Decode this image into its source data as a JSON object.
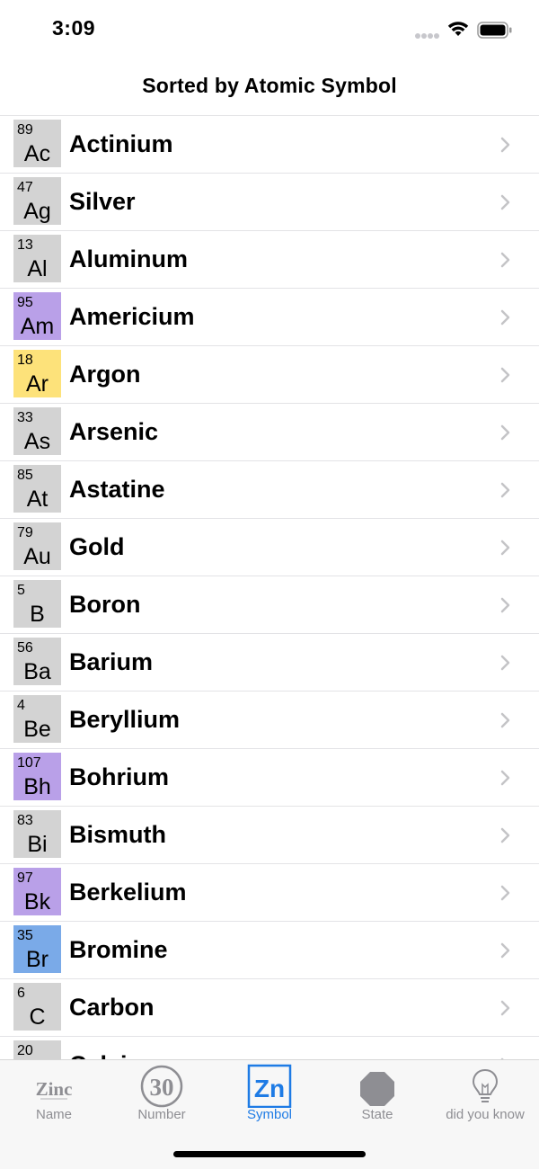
{
  "status": {
    "time": "3:09"
  },
  "nav": {
    "title": "Sorted by Atomic Symbol"
  },
  "elements": [
    {
      "number": "89",
      "symbol": "Ac",
      "name": "Actinium",
      "color": "#d3d3d3"
    },
    {
      "number": "47",
      "symbol": "Ag",
      "name": "Silver",
      "color": "#d3d3d3"
    },
    {
      "number": "13",
      "symbol": "Al",
      "name": "Aluminum",
      "color": "#d3d3d3"
    },
    {
      "number": "95",
      "symbol": "Am",
      "name": "Americium",
      "color": "#b9a0e8"
    },
    {
      "number": "18",
      "symbol": "Ar",
      "name": "Argon",
      "color": "#fde27a"
    },
    {
      "number": "33",
      "symbol": "As",
      "name": "Arsenic",
      "color": "#d3d3d3"
    },
    {
      "number": "85",
      "symbol": "At",
      "name": "Astatine",
      "color": "#d3d3d3"
    },
    {
      "number": "79",
      "symbol": "Au",
      "name": "Gold",
      "color": "#d3d3d3"
    },
    {
      "number": "5",
      "symbol": "B",
      "name": "Boron",
      "color": "#d3d3d3"
    },
    {
      "number": "56",
      "symbol": "Ba",
      "name": "Barium",
      "color": "#d3d3d3"
    },
    {
      "number": "4",
      "symbol": "Be",
      "name": "Beryllium",
      "color": "#d3d3d3"
    },
    {
      "number": "107",
      "symbol": "Bh",
      "name": "Bohrium",
      "color": "#b9a0e8"
    },
    {
      "number": "83",
      "symbol": "Bi",
      "name": "Bismuth",
      "color": "#d3d3d3"
    },
    {
      "number": "97",
      "symbol": "Bk",
      "name": "Berkelium",
      "color": "#b9a0e8"
    },
    {
      "number": "35",
      "symbol": "Br",
      "name": "Bromine",
      "color": "#7aaae8"
    },
    {
      "number": "6",
      "symbol": "C",
      "name": "Carbon",
      "color": "#d3d3d3"
    },
    {
      "number": "20",
      "symbol": "Ca",
      "name": "Calcium",
      "color": "#d3d3d3"
    }
  ],
  "tabs": [
    {
      "label": "Name",
      "icon": "zinc-text-icon",
      "icon_text": "Zinc"
    },
    {
      "label": "Number",
      "icon": "number-circle-icon",
      "icon_text": "30"
    },
    {
      "label": "Symbol",
      "icon": "symbol-box-icon",
      "icon_text": "Zn"
    },
    {
      "label": "State",
      "icon": "octagon-icon"
    },
    {
      "label": "did you know",
      "icon": "lightbulb-icon"
    }
  ],
  "active_tab": "Symbol",
  "colors": {
    "accent": "#1e7be5",
    "inactive_tab": "#8e8e93",
    "separator": "#e3e3e6"
  }
}
